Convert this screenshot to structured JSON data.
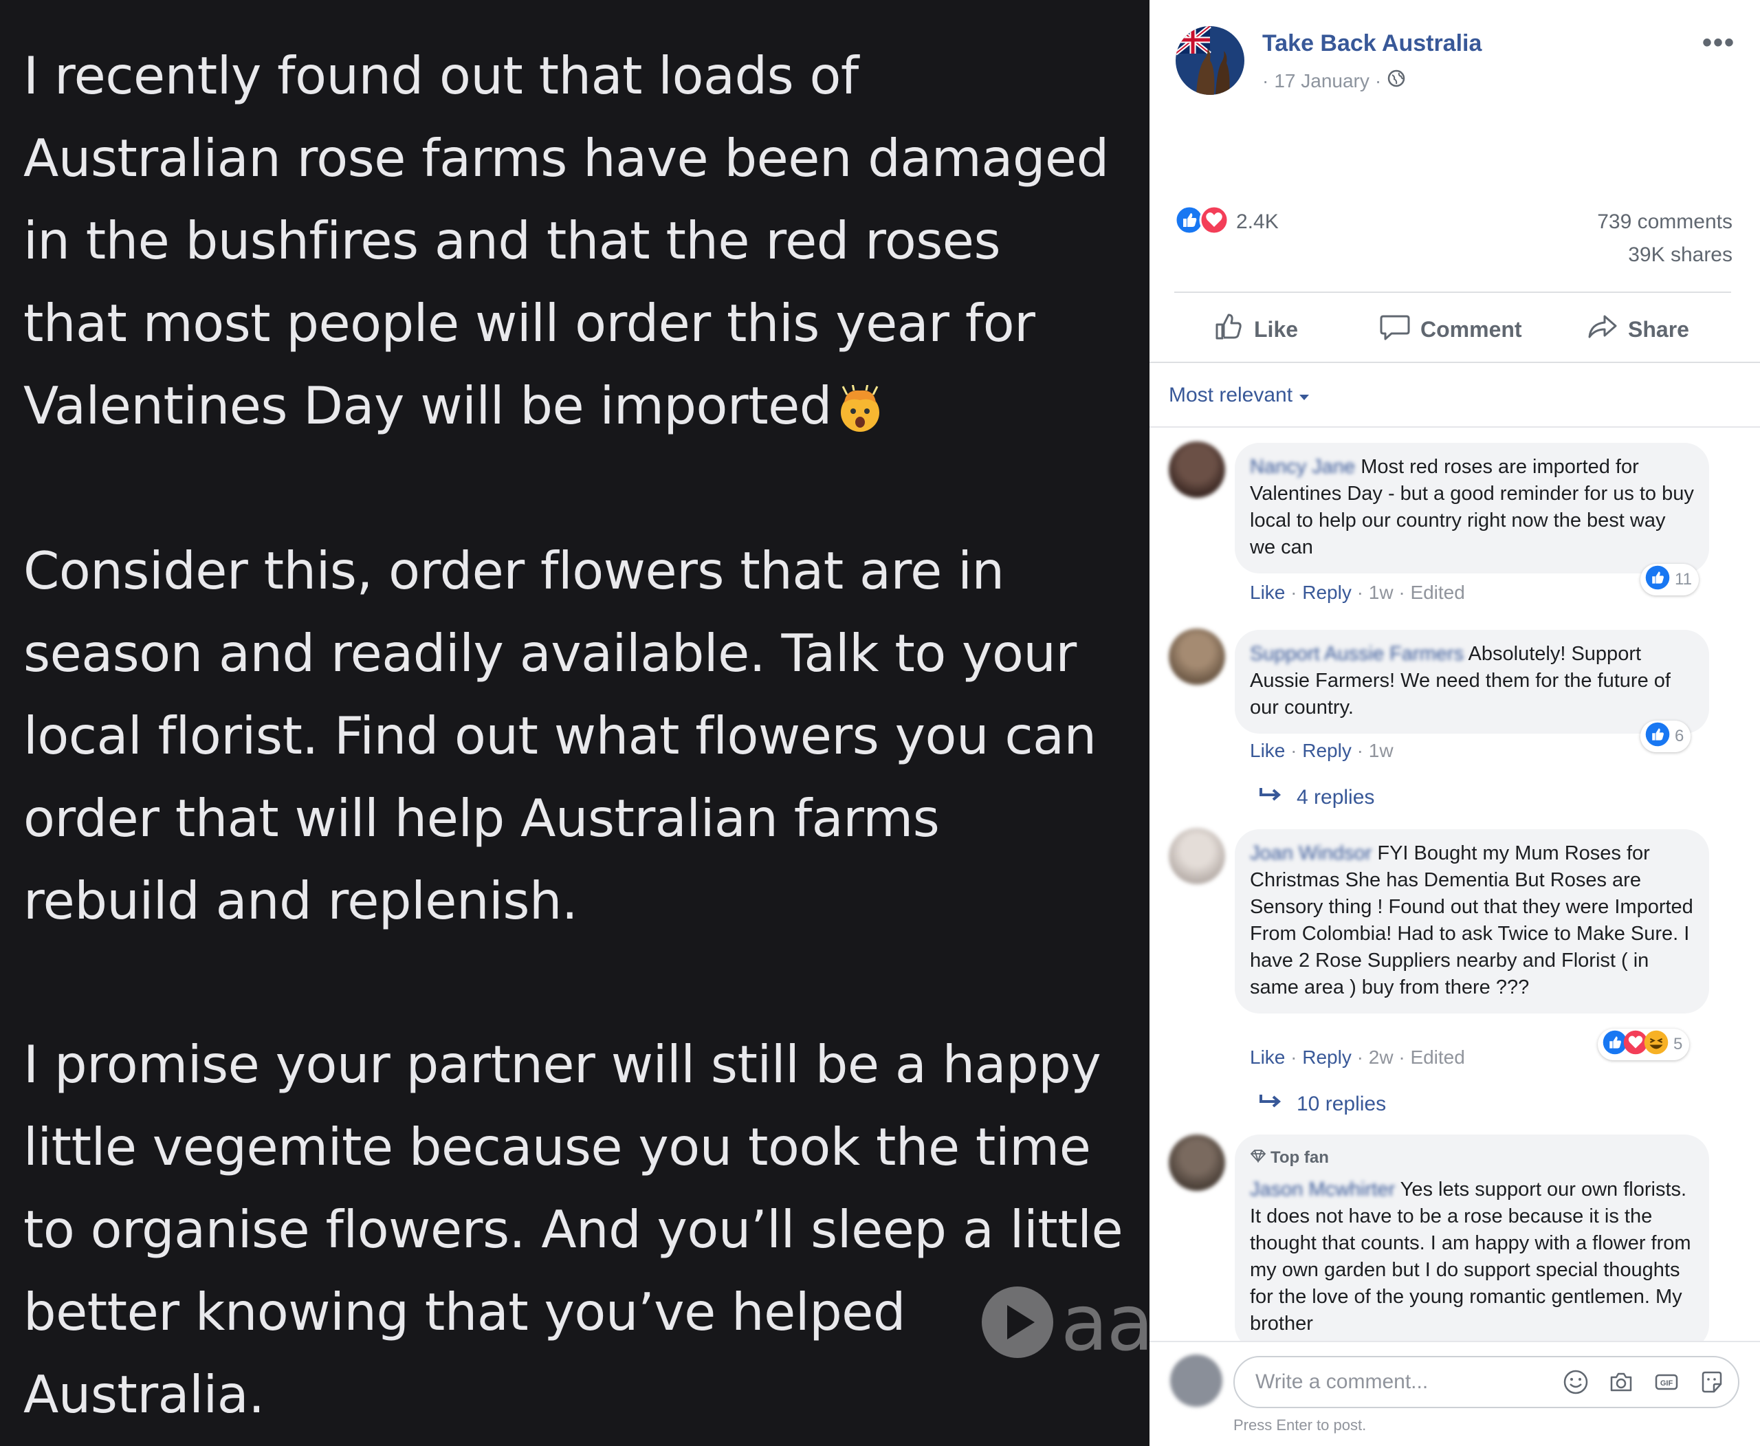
{
  "post_image": {
    "paragraphs": [
      [
        "I recently found out that loads of",
        "Australian rose farms have been damaged",
        "in the bushfires and that the red roses",
        "that most people will order this year for",
        "Valentines Day will be imported"
      ],
      [
        "Consider this, order flowers that are in",
        "season and readily available. Talk to your",
        "local florist. Find out what flowers you can",
        "order that will help Australian farms",
        "rebuild and replenish."
      ],
      [
        "I promise your partner will still be a happy",
        "little vegemite because you took the time",
        "to organise flowers. And you’ll sleep a little",
        "better knowing that you’ve helped",
        "Australia."
      ]
    ],
    "watermark": "aa"
  },
  "post": {
    "page_name": "Take Back Australia",
    "date": "17 January",
    "reaction_count": "2.4K",
    "comments_count": "739 comments",
    "shares_count": "39K shares",
    "actions": {
      "like": "Like",
      "comment": "Comment",
      "share": "Share"
    }
  },
  "sort": {
    "label": "Most relevant"
  },
  "comments": [
    {
      "author": "Nancy Jane",
      "text": "Most red roses are imported for Valentines Day - but a good reminder for us to buy local to help our country right now the best way we can",
      "like": "Like",
      "reply": "Reply",
      "time": "1w",
      "edited": "Edited",
      "reactions": "11"
    },
    {
      "author": "Support Aussie Farmers",
      "text": "Absolutely! Support Aussie Farmers! We need them for the future of our country.",
      "like": "Like",
      "reply": "Reply",
      "time": "1w",
      "reactions": "6",
      "replies": "4 replies"
    },
    {
      "author": "Joan Windsor",
      "text": "FYI Bought my Mum Roses for Christmas She has Dementia But Roses are Sensory thing ! Found out that they were Imported From Colombia! Had to ask Twice to Make Sure. I have 2 Rose Suppliers nearby and Florist ( in same area ) buy from there ???",
      "like": "Like",
      "reply": "Reply",
      "time": "2w",
      "edited": "Edited",
      "reactions": "5",
      "replies": "10 replies"
    },
    {
      "badge": "Top fan",
      "author": "Jason Mcwhirter",
      "text": "Yes lets support our own florists. It does not have to be a rose because it is the thought that counts. I am happy with a flower from my own garden but I do support special thoughts for the love of the young romantic gentlemen. My brother"
    }
  ],
  "composer": {
    "placeholder": "Write a comment...",
    "hint": "Press Enter to post."
  },
  "colors": {
    "link": "#385898",
    "image_bg": "#17171a",
    "like_blue": "#1877f2",
    "love_red": "#f33e58"
  }
}
